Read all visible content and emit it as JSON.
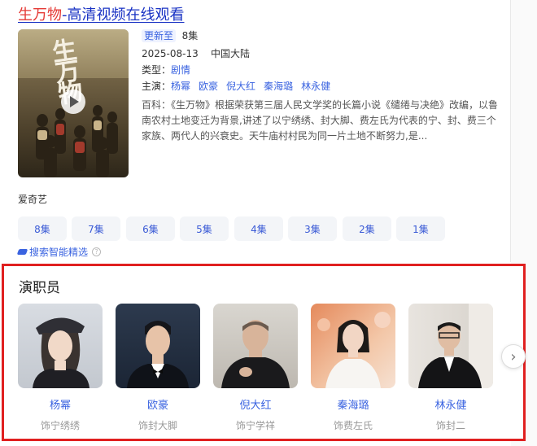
{
  "title": {
    "highlight": "生万物",
    "rest": "-高清视频在线观看"
  },
  "meta": {
    "update_badge": "更新至",
    "episodes": "8集",
    "date": "2025-08-13",
    "region": "中国大陆",
    "genre_label": "类型：",
    "genre": "剧情",
    "cast_label": "主演：",
    "cast": [
      "杨幂",
      "欧豪",
      "倪大红",
      "秦海璐",
      "林永健"
    ],
    "bk_label": "百科：",
    "bk_text": "《生万物》根据荣获第三届人民文学奖的长篇小说《缱绻与决绝》改编，以鲁南农村土地变迁为背景,讲述了以宁绣绣、封大脚、费左氏为代表的宁、封、费三个家族、两代人的兴衰史。天牛庙村村民为同一片土地不断努力,是..."
  },
  "poster": {
    "calligraphy": "生万物",
    "play_icon": "play-icon"
  },
  "source": "爱奇艺",
  "episode_buttons": [
    "8集",
    "7集",
    "6集",
    "5集",
    "4集",
    "3集",
    "2集",
    "1集"
  ],
  "smart_pick": "搜索智能精选",
  "cast_section": {
    "title": "演职员",
    "actors": [
      {
        "name": "杨幂",
        "role": "饰宁绣绣"
      },
      {
        "name": "欧豪",
        "role": "饰封大脚"
      },
      {
        "name": "倪大红",
        "role": "饰宁学祥"
      },
      {
        "name": "秦海璐",
        "role": "饰费左氏"
      },
      {
        "name": "林永健",
        "role": "饰封二"
      }
    ],
    "next_icon": "chevron-right-icon"
  },
  "colors": {
    "link": "#3a63e0",
    "highlight": "#e53935",
    "frame": "#e02020"
  }
}
